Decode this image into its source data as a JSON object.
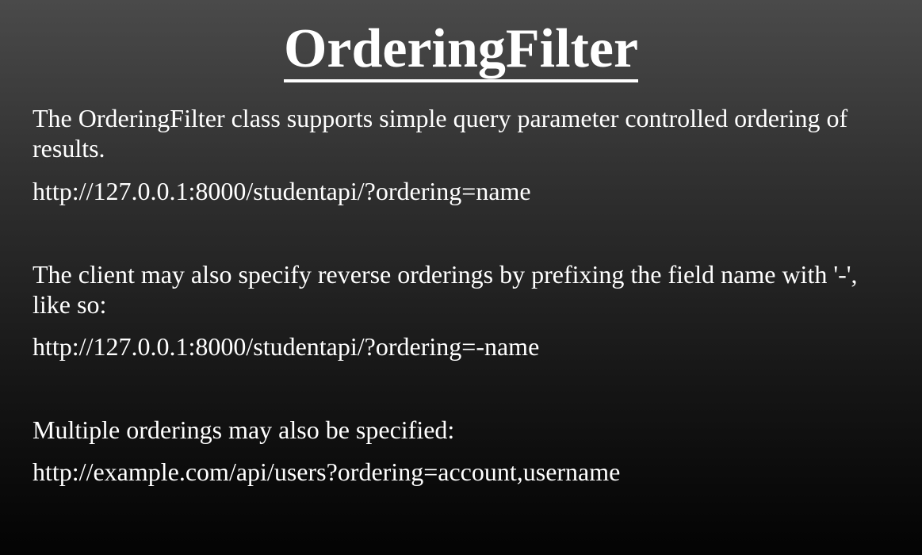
{
  "slide": {
    "title": "OrderingFilter",
    "paragraph_1": "The OrderingFilter class supports simple query parameter controlled ordering of results.",
    "url_1": "http://127.0.0.1:8000/studentapi/?ordering=name",
    "paragraph_2": "The client may also specify reverse orderings by prefixing the field name with '-', like so:",
    "url_2": "http://127.0.0.1:8000/studentapi/?ordering=-name",
    "paragraph_3": "Multiple orderings may also be specified:",
    "url_3": "http://example.com/api/users?ordering=account,username"
  },
  "colors": {
    "text": "#ffffff",
    "background_top": "#4a4a4a",
    "background_bottom": "#030303"
  }
}
